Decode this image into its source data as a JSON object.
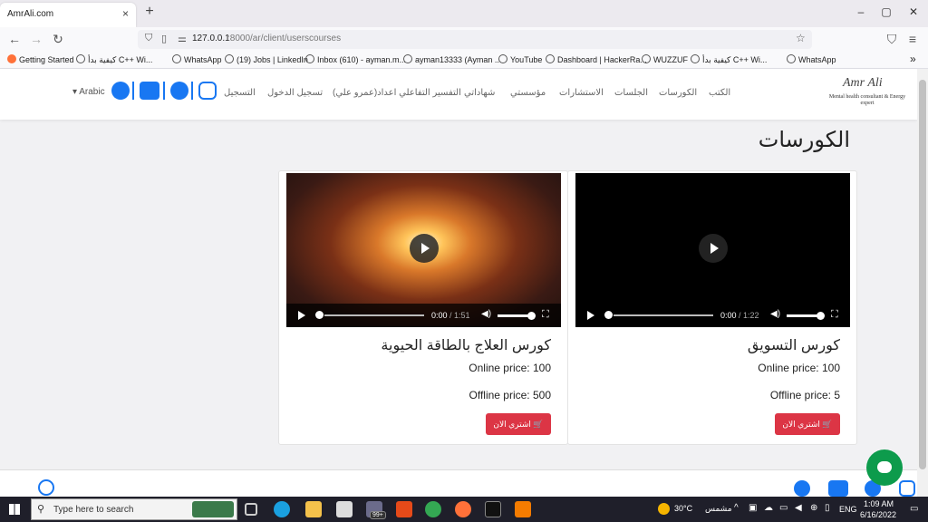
{
  "browser": {
    "tab_title": "AmrAli.com",
    "tab_close": "×",
    "new_tab": "+",
    "win_min": "–",
    "win_max": "▢",
    "win_close": "✕",
    "url_host": "127.0.0.1",
    "url_rest": ":8000/ar/client/userscourses"
  },
  "bookmarks": [
    "Getting Started",
    "كيفية بدأ C++ Wi...",
    "WhatsApp",
    "(19) Jobs | LinkedIn",
    "Inbox (610) - ayman.m...",
    "ayman13333 (Ayman ...",
    "YouTube",
    "Dashboard | HackerRa...",
    "WUZZUF",
    "كيفية بدأ C++ Wi...",
    "WhatsApp"
  ],
  "site": {
    "logo_script": "Amr Ali",
    "logo_sub": "Mental health consultant & Energy expert",
    "menu": [
      "الكتب",
      "الكورسات",
      "الجلسات",
      "الاستشارات",
      "مؤسستي",
      "شهاداتي",
      "التفسير التفاعلي اعداد(عمرو علي)",
      "تسجيل الدخول",
      "التسجيل"
    ],
    "language": "Arabic"
  },
  "page_title": "الكورسات",
  "courses": [
    {
      "title": "كورس التسويق",
      "online_price": "Online price: 100",
      "offline_price": "Offline price: 5",
      "buy_label": "اشتري الان",
      "time": "0:00",
      "duration": "/ 1:22"
    },
    {
      "title": "كورس العلاج بالطاقة الحيوية",
      "online_price": "Online price: 100",
      "offline_price": "Offline price: 500",
      "buy_label": "اشتري الان",
      "time": "0:00",
      "duration": "/ 1:51"
    }
  ],
  "taskbar": {
    "search_placeholder": "Type here to search",
    "weather": "30°C",
    "weather_label": "مشمس",
    "lang": "ENG",
    "time": "1:09 AM",
    "date": "6/16/2022",
    "badge": "99+"
  }
}
